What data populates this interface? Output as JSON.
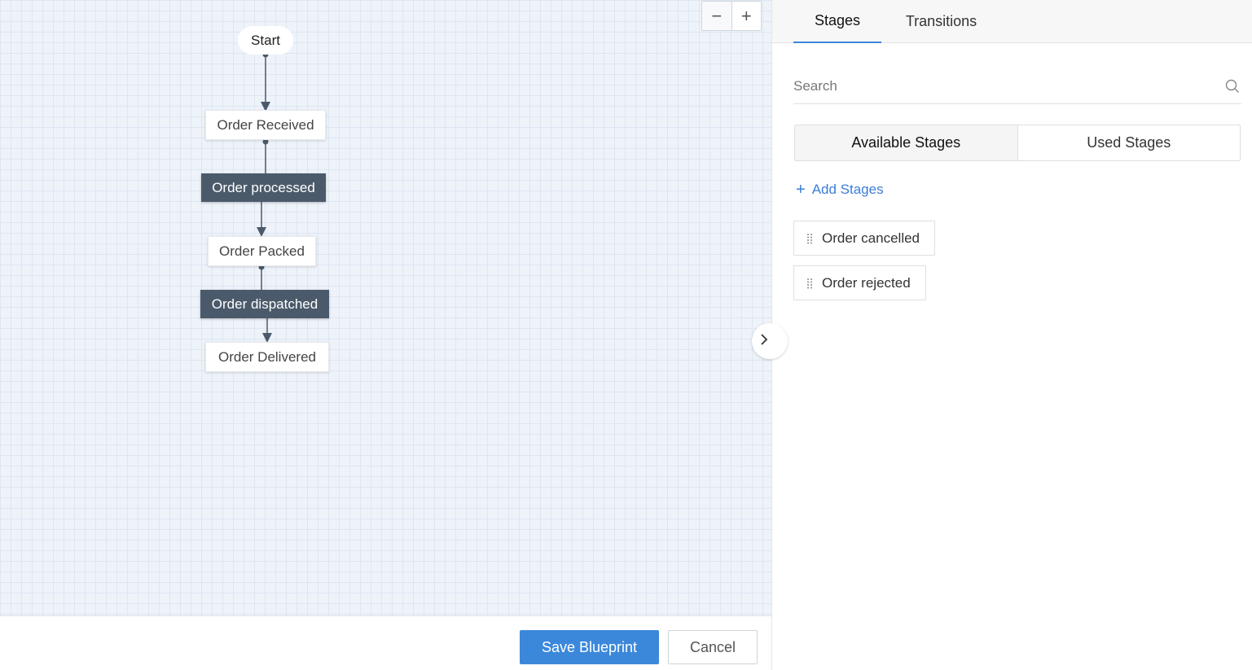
{
  "canvas": {
    "zoom_out_label": "−",
    "zoom_in_label": "+",
    "collapse_icon": "chevron-right-icon",
    "nodes": {
      "start": "Start",
      "order_received": "Order Received",
      "order_processed": "Order processed",
      "order_packed": "Order Packed",
      "order_dispatched": "Order dispatched",
      "order_delivered": "Order Delivered"
    }
  },
  "footer": {
    "save_label": "Save Blueprint",
    "cancel_label": "Cancel"
  },
  "panel": {
    "tabs": [
      {
        "label": "Stages",
        "active": true
      },
      {
        "label": "Transitions",
        "active": false
      }
    ],
    "search": {
      "placeholder": "Search",
      "value": ""
    },
    "segments": [
      {
        "label": "Available Stages",
        "active": true
      },
      {
        "label": "Used Stages",
        "active": false
      }
    ],
    "add_stages_label": "Add Stages",
    "stages": [
      {
        "label": "Order cancelled"
      },
      {
        "label": "Order rejected"
      }
    ]
  },
  "colors": {
    "accent": "#3b88db",
    "dark_node": "#4b5a6b",
    "canvas_bg": "#eef3fa"
  }
}
